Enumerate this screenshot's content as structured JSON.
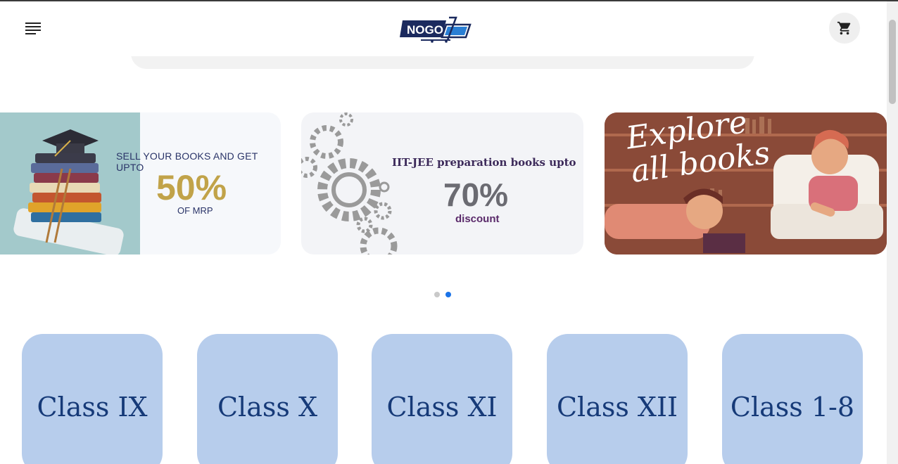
{
  "header": {
    "logo_text": "NOGO",
    "menu_icon": "hamburger-menu-icon",
    "cart_icon": "shopping-cart-icon"
  },
  "search": {
    "placeholder": ""
  },
  "banners": [
    {
      "line1": "SELL YOUR BOOKS AND GET UPTO",
      "value": "50%",
      "line3": "OF MRP"
    },
    {
      "line1": "IIT-JEE preparation books upto",
      "value": "70%",
      "line3": "discount"
    },
    {
      "line1": "Explore all books"
    }
  ],
  "carousel": {
    "active_dot": 2,
    "dot_count": 2
  },
  "classes": [
    {
      "label": "Class IX"
    },
    {
      "label": "Class X"
    },
    {
      "label": "Class XI"
    },
    {
      "label": "Class XII"
    },
    {
      "label": "Class 1-8"
    }
  ],
  "colors": {
    "accent": "#1a73e8",
    "card_bg": "#b7cdec",
    "card_text": "#163a78"
  }
}
